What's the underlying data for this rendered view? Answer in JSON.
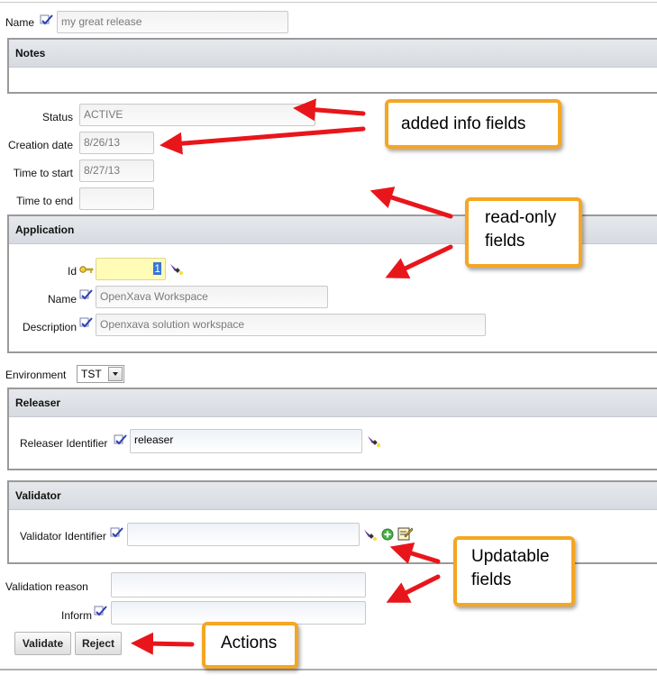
{
  "header": {
    "name_label": "Name",
    "name_value": "my great release"
  },
  "notes": {
    "title": "Notes"
  },
  "info_fields": {
    "status_label": "Status",
    "status_value": "ACTIVE",
    "creation_date_label": "Creation date",
    "creation_date_value": "8/26/13",
    "time_to_start_label": "Time to start",
    "time_to_start_value": "8/27/13",
    "time_to_end_label": "Time to end",
    "time_to_end_value": ""
  },
  "application": {
    "title": "Application",
    "id_label": "Id",
    "id_value": "1",
    "name_label": "Name",
    "name_value": "OpenXava Workspace",
    "description_label": "Description",
    "description_value": "Openxava solution workspace"
  },
  "environment": {
    "label": "Environment",
    "selected": "TST"
  },
  "releaser": {
    "title": "Releaser",
    "identifier_label": "Releaser Identifier",
    "identifier_value": "releaser"
  },
  "validator": {
    "title": "Validator",
    "identifier_label": "Validator Identifier",
    "identifier_value": ""
  },
  "validation": {
    "reason_label": "Validation reason",
    "reason_value": "",
    "inform_label": "Inform",
    "inform_value": ""
  },
  "actions": {
    "validate_label": "Validate",
    "reject_label": "Reject"
  },
  "annotations": {
    "added_info": "added info fields",
    "read_only_1": "read-only",
    "read_only_2": "fields",
    "updatable_1": "Updatable",
    "updatable_2": "fields",
    "actions": "Actions"
  },
  "icons": {
    "edit": "pencil-check-icon",
    "key": "key-icon",
    "search": "flashlight-search-icon",
    "add": "add-circle-icon",
    "edit_record": "edit-record-icon",
    "arrow": "red-arrow-icon"
  },
  "colors": {
    "callout_border": "#f5a623",
    "arrow": "#e8161b",
    "key_field_bg": "#fffcb8"
  }
}
